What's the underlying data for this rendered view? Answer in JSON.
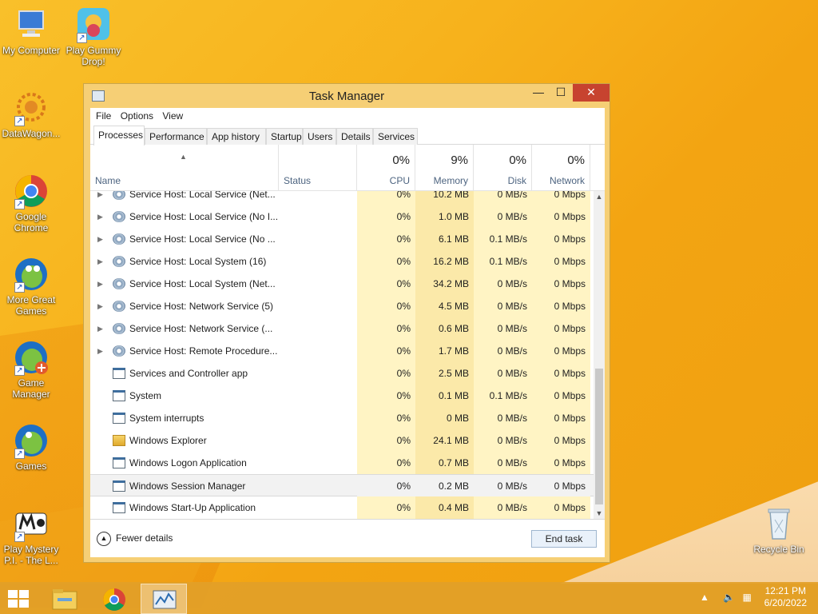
{
  "desktop": {
    "icons": [
      {
        "label": "My Computer",
        "icon": "computer-icon"
      },
      {
        "label": "Play Gummy Drop!",
        "icon": "gummy-drop-icon"
      },
      {
        "label": "DataWagon...",
        "icon": "datawagon-icon"
      },
      {
        "label": "Google Chrome",
        "icon": "chrome-icon"
      },
      {
        "label": "More Great Games",
        "icon": "frog-icon"
      },
      {
        "label": "Game Manager",
        "icon": "game-manager-icon"
      },
      {
        "label": "Games",
        "icon": "games-icon"
      },
      {
        "label": "Play Mystery P.I. - The L...",
        "icon": "mystery-pi-icon"
      },
      {
        "label": "Recycle Bin",
        "icon": "recycle-bin-icon"
      }
    ]
  },
  "window": {
    "title": "Task Manager",
    "controls": {
      "minimize": "—",
      "maximize": "☐",
      "close": "✕"
    }
  },
  "menu": {
    "file": "File",
    "options": "Options",
    "view": "View"
  },
  "tabs": [
    "Processes",
    "Performance",
    "App history",
    "Startup",
    "Users",
    "Details",
    "Services"
  ],
  "active_tab": "Processes",
  "columns": {
    "name": "Name",
    "status": "Status",
    "cpu": {
      "percent": "0%",
      "label": "CPU"
    },
    "memory": {
      "percent": "9%",
      "label": "Memory"
    },
    "disk": {
      "percent": "0%",
      "label": "Disk"
    },
    "network": {
      "percent": "0%",
      "label": "Network"
    }
  },
  "processes": [
    {
      "name": "Service Host: Local Service (Net...",
      "cpu": "0%",
      "memory": "10.2 MB",
      "disk": "0 MB/s",
      "network": "0 Mbps",
      "expandable": true,
      "icon": "gear"
    },
    {
      "name": "Service Host: Local Service (No I...",
      "cpu": "0%",
      "memory": "1.0 MB",
      "disk": "0 MB/s",
      "network": "0 Mbps",
      "expandable": true,
      "icon": "gear"
    },
    {
      "name": "Service Host: Local Service (No ...",
      "cpu": "0%",
      "memory": "6.1 MB",
      "disk": "0.1 MB/s",
      "network": "0 Mbps",
      "expandable": true,
      "icon": "gear"
    },
    {
      "name": "Service Host: Local System (16)",
      "cpu": "0%",
      "memory": "16.2 MB",
      "disk": "0.1 MB/s",
      "network": "0 Mbps",
      "expandable": true,
      "icon": "gear"
    },
    {
      "name": "Service Host: Local System (Net...",
      "cpu": "0%",
      "memory": "34.2 MB",
      "disk": "0 MB/s",
      "network": "0 Mbps",
      "expandable": true,
      "icon": "gear"
    },
    {
      "name": "Service Host: Network Service (5)",
      "cpu": "0%",
      "memory": "4.5 MB",
      "disk": "0 MB/s",
      "network": "0 Mbps",
      "expandable": true,
      "icon": "gear"
    },
    {
      "name": "Service Host: Network Service (...",
      "cpu": "0%",
      "memory": "0.6 MB",
      "disk": "0 MB/s",
      "network": "0 Mbps",
      "expandable": true,
      "icon": "gear"
    },
    {
      "name": "Service Host: Remote Procedure...",
      "cpu": "0%",
      "memory": "1.7 MB",
      "disk": "0 MB/s",
      "network": "0 Mbps",
      "expandable": true,
      "icon": "gear"
    },
    {
      "name": "Services and Controller app",
      "cpu": "0%",
      "memory": "2.5 MB",
      "disk": "0 MB/s",
      "network": "0 Mbps",
      "expandable": false,
      "icon": "win"
    },
    {
      "name": "System",
      "cpu": "0%",
      "memory": "0.1 MB",
      "disk": "0.1 MB/s",
      "network": "0 Mbps",
      "expandable": false,
      "icon": "win"
    },
    {
      "name": "System interrupts",
      "cpu": "0%",
      "memory": "0 MB",
      "disk": "0 MB/s",
      "network": "0 Mbps",
      "expandable": false,
      "icon": "win"
    },
    {
      "name": "Windows Explorer",
      "cpu": "0%",
      "memory": "24.1 MB",
      "disk": "0 MB/s",
      "network": "0 Mbps",
      "expandable": false,
      "icon": "folder"
    },
    {
      "name": "Windows Logon Application",
      "cpu": "0%",
      "memory": "0.7 MB",
      "disk": "0 MB/s",
      "network": "0 Mbps",
      "expandable": false,
      "icon": "win"
    },
    {
      "name": "Windows Session Manager",
      "cpu": "0%",
      "memory": "0.2 MB",
      "disk": "0 MB/s",
      "network": "0 Mbps",
      "expandable": false,
      "icon": "win",
      "selected": true
    },
    {
      "name": "Windows Start-Up Application",
      "cpu": "0%",
      "memory": "0.4 MB",
      "disk": "0 MB/s",
      "network": "0 Mbps",
      "expandable": false,
      "icon": "win"
    }
  ],
  "footer": {
    "fewer_details": "Fewer details",
    "end_task": "End task"
  },
  "taskbar": {
    "apps": [
      "file-explorer-icon",
      "chrome-icon",
      "task-manager-icon"
    ],
    "active_app": "task-manager-icon",
    "time": "12:21 PM",
    "date": "6/20/2022"
  }
}
